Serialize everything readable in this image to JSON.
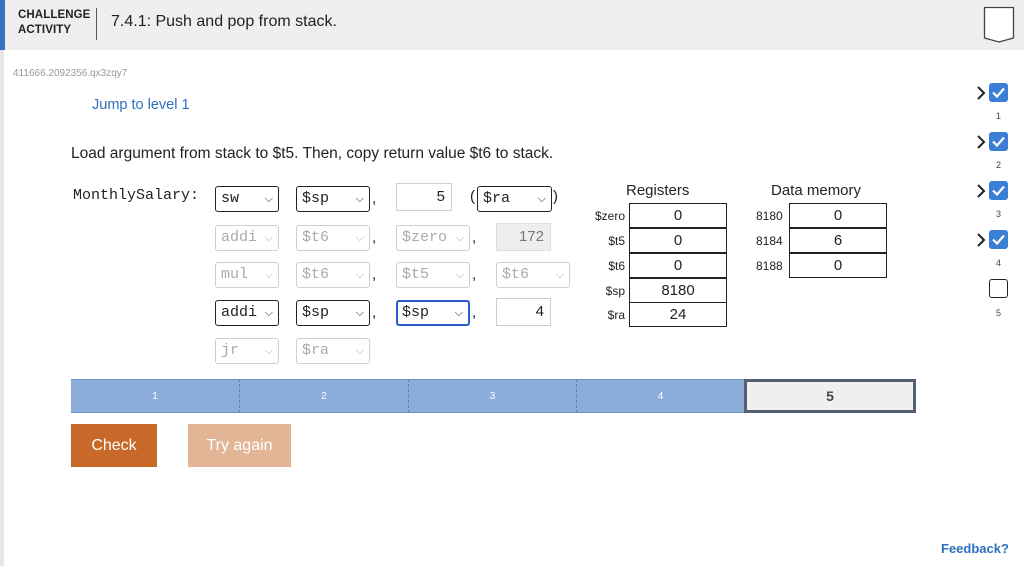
{
  "header": {
    "activity_label_line1": "CHALLENGE",
    "activity_label_line2": "ACTIVITY",
    "title": "7.4.1: Push and pop from stack."
  },
  "activity_id": "411666.2092356.qx3zqy7",
  "jump_link": "Jump to level 1",
  "instructions": "Load argument from stack to $t5. Then, copy return value $t6 to stack.",
  "code": {
    "label": "MonthlySalary:",
    "lines": [
      {
        "op": "sw",
        "arg1": "$sp",
        "arg2": "5",
        "arg3": "$ra",
        "open_paren": "(",
        "close_paren": ")"
      },
      {
        "op": "addi",
        "arg1": "$t6",
        "arg2": "$zero",
        "arg3": "172"
      },
      {
        "op": "mul",
        "arg1": "$t6",
        "arg2": "$t5",
        "arg3": "$t6"
      },
      {
        "op": "addi",
        "arg1": "$sp",
        "arg2": "$sp",
        "arg3": "4"
      },
      {
        "op": "jr",
        "arg1": "$ra"
      }
    ],
    "comma": ","
  },
  "registers": {
    "title": "Registers",
    "rows": [
      {
        "name": "$zero",
        "value": "0"
      },
      {
        "name": "$t5",
        "value": "0"
      },
      {
        "name": "$t6",
        "value": "0"
      },
      {
        "name": "$sp",
        "value": "8180"
      },
      {
        "name": "$ra",
        "value": "24"
      }
    ]
  },
  "memory": {
    "title": "Data memory",
    "rows": [
      {
        "address": "8180",
        "value": "0"
      },
      {
        "address": "8184",
        "value": "6"
      },
      {
        "address": "8188",
        "value": "0"
      }
    ]
  },
  "progress": {
    "segments": [
      "1",
      "2",
      "3",
      "4",
      "5"
    ],
    "current": "5"
  },
  "buttons": {
    "check": "Check",
    "try_again": "Try again"
  },
  "feedback": "Feedback?",
  "levels": [
    {
      "number": "1",
      "done": true
    },
    {
      "number": "2",
      "done": true
    },
    {
      "number": "3",
      "done": true
    },
    {
      "number": "4",
      "done": true
    },
    {
      "number": "5",
      "done": false
    }
  ],
  "colors": {
    "accent": "#3a72c4",
    "check_button": "#c8692a",
    "try_button": "#e2b597",
    "progress_complete": "#8aaed9",
    "link": "#2e6fbf"
  },
  "icons": {
    "bookmark": "bookmark-icon",
    "dropdown": "chevron-down-icon",
    "level_done": "checkmark-icon",
    "level_current": "arrow-right-icon"
  }
}
